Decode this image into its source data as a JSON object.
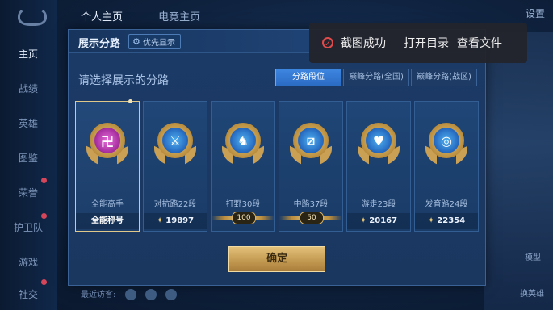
{
  "sidebar": {
    "items": [
      {
        "label": "主页",
        "active": true
      },
      {
        "label": "战绩"
      },
      {
        "label": "英雄"
      },
      {
        "label": "图鉴"
      },
      {
        "label": "荣誉"
      },
      {
        "label": "护卫队"
      },
      {
        "label": "游戏"
      },
      {
        "label": "社交"
      }
    ]
  },
  "topnav": {
    "tab1": "个人主页",
    "tab2": "电竞主页",
    "settings": "设置"
  },
  "panel": {
    "title": "展示分路",
    "priority_label": "优先显示",
    "subtitle": "请选择展示的分路",
    "tabs": [
      "分路段位",
      "巅峰分路(全国)",
      "巅峰分路(战区)"
    ],
    "cards": [
      {
        "label": "全能高手",
        "value": "全能称号",
        "selected": true
      },
      {
        "label": "对抗路22段",
        "value": "19897"
      },
      {
        "label": "打野30段",
        "value": "100"
      },
      {
        "label": "中路37段",
        "value": "50"
      },
      {
        "label": "游走23段",
        "value": "20167"
      },
      {
        "label": "发育路24段",
        "value": "22354"
      }
    ],
    "confirm": "确定"
  },
  "toast": {
    "message": "截图成功",
    "open_dir": "打开目录",
    "view_file": "查看文件"
  },
  "background": {
    "label1": "模型",
    "label2": "换英雄",
    "bottom_hint": "最近访客:"
  },
  "colors": {
    "accent_blue": "#2b6bc4",
    "gold": "#c49b52",
    "toast_check": "#e04b4b"
  }
}
